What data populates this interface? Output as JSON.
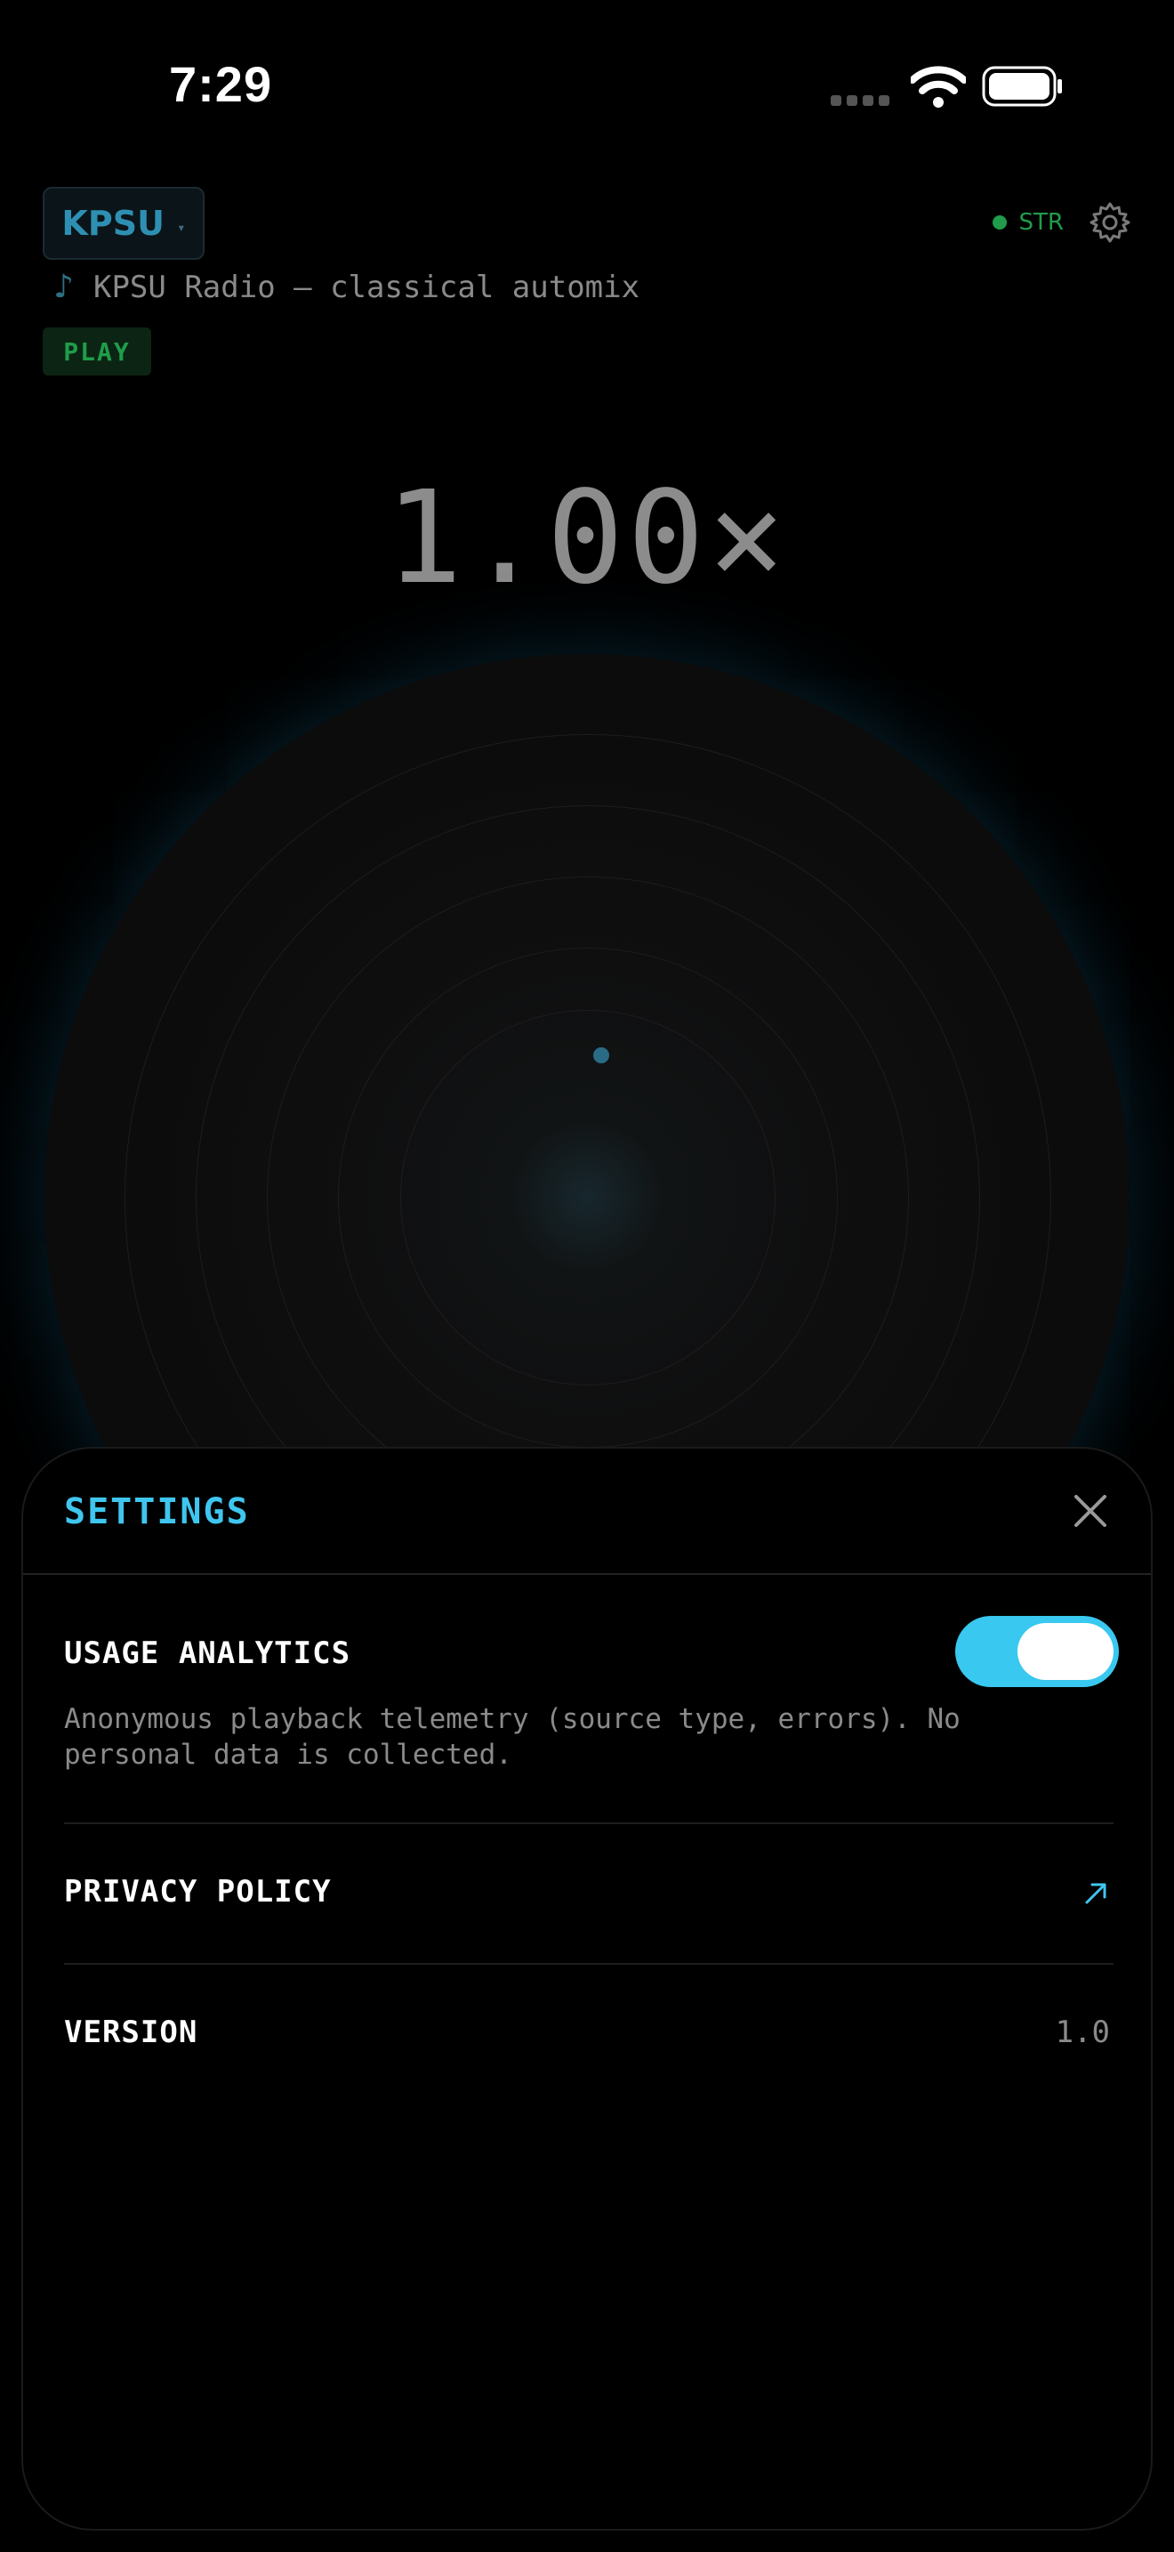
{
  "status_bar": {
    "time": "7:29"
  },
  "station": {
    "name": "KPSU",
    "caret": "▾"
  },
  "stream_status": {
    "label": "STR",
    "color": "#1f9d4a"
  },
  "now_playing": {
    "note_glyph": "♪",
    "title": "KPSU Radio — classical automix"
  },
  "play_badge": "PLAY",
  "speed": "1.00×",
  "settings": {
    "title": "SETTINGS",
    "usage_analytics": {
      "label": "USAGE ANALYTICS",
      "description": "Anonymous playback telemetry (source type, errors). No personal data is collected.",
      "enabled": true
    },
    "privacy_policy": {
      "label": "PRIVACY POLICY"
    },
    "version": {
      "label": "VERSION",
      "value": "1.0"
    }
  },
  "colors": {
    "accent": "#3fc6ef",
    "station": "#2e8fb2",
    "green": "#1f9d4a"
  },
  "icons": [
    "wifi-icon",
    "battery-icon",
    "gear-icon",
    "music-note-icon",
    "close-icon",
    "external-link-icon"
  ]
}
